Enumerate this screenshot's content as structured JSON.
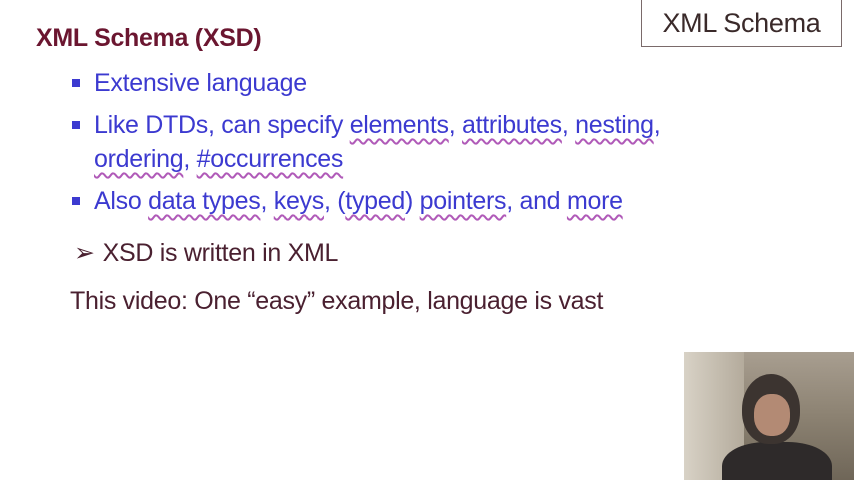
{
  "slide": {
    "title_box": "XML Schema",
    "heading": "XML Schema (XSD)",
    "bullets": [
      {
        "segments": [
          {
            "text": "Extensive language",
            "underline": false
          }
        ]
      },
      {
        "segments": [
          {
            "text": "Like DTDs, can specify ",
            "underline": false
          },
          {
            "text": "elements",
            "underline": true
          },
          {
            "text": ", ",
            "underline": false
          },
          {
            "text": "attributes",
            "underline": true
          },
          {
            "text": ", ",
            "underline": false
          },
          {
            "text": "nesting",
            "underline": true
          },
          {
            "text": ", ",
            "underline": false
          },
          {
            "text": "ordering",
            "underline": true
          },
          {
            "text": ", ",
            "underline": false
          },
          {
            "text": "#occurrences",
            "underline": true
          }
        ]
      },
      {
        "segments": [
          {
            "text": "Also ",
            "underline": false
          },
          {
            "text": "data types",
            "underline": true
          },
          {
            "text": ", ",
            "underline": false
          },
          {
            "text": "keys",
            "underline": true
          },
          {
            "text": ", (",
            "underline": false
          },
          {
            "text": "typed",
            "underline": true
          },
          {
            "text": ") ",
            "underline": false
          },
          {
            "text": "pointers",
            "underline": true
          },
          {
            "text": ", and ",
            "underline": false
          },
          {
            "text": "more",
            "underline": true
          }
        ]
      }
    ],
    "arrow_item": "XSD is written in XML",
    "note": "This video: One “easy” example, language is vast"
  },
  "colors": {
    "heading": "#6b1630",
    "bullet_text": "#3c3ad0",
    "annotation": "#b05ab8",
    "body_text": "#4a2030"
  },
  "icons": {
    "bullet": "square-bullet-icon",
    "arrow": "arrow-right-icon"
  }
}
